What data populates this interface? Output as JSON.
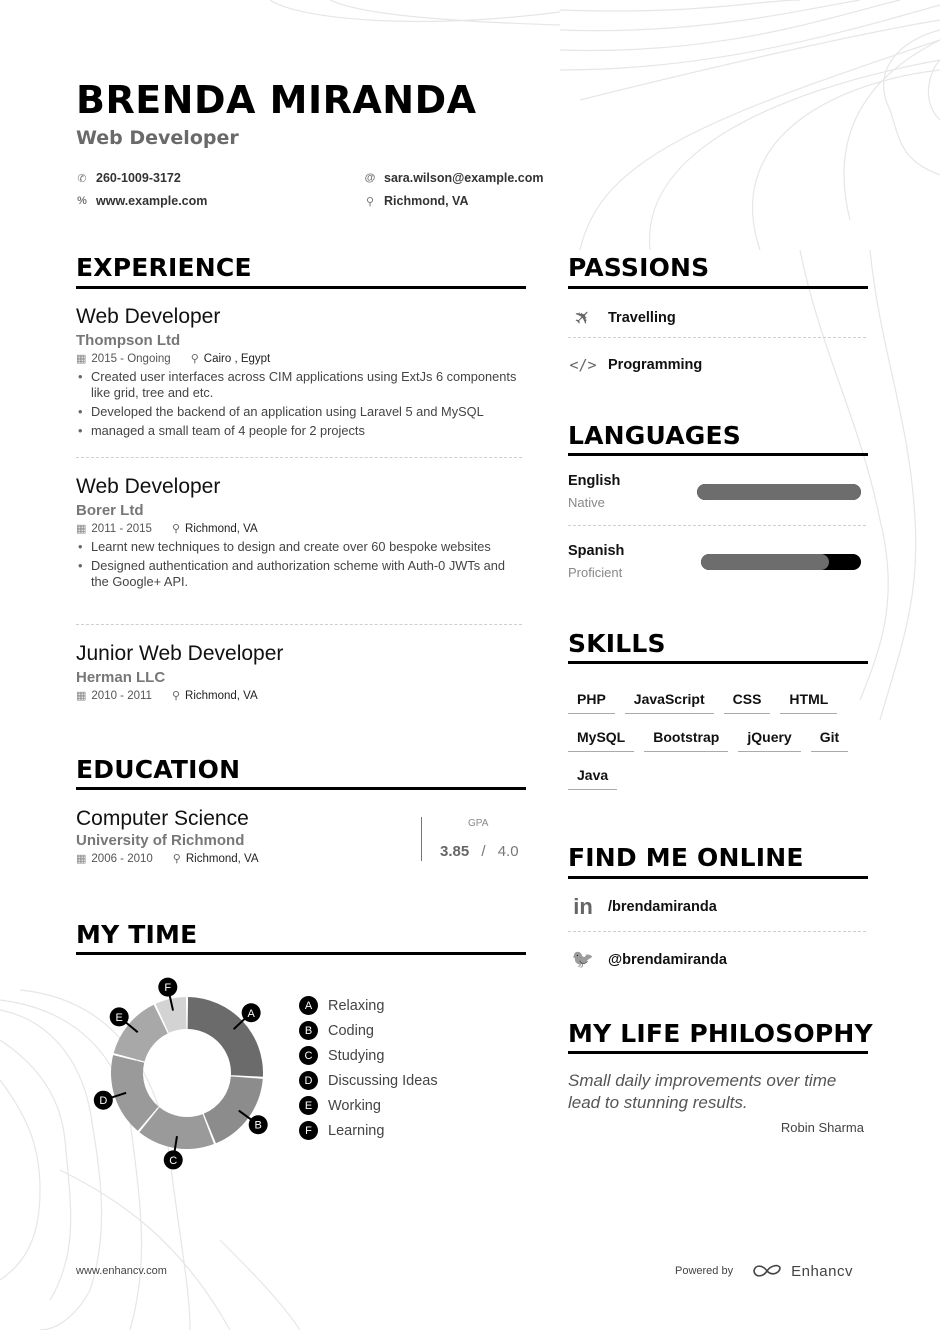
{
  "header": {
    "name": "BRENDA MIRANDA",
    "title": "Web Developer",
    "contacts": [
      {
        "icon": "phone-icon",
        "glyph": "✆",
        "value": "260-1009-3172"
      },
      {
        "icon": "at-icon",
        "glyph": "@",
        "value": "sara.wilson@example.com"
      },
      {
        "icon": "link-icon",
        "glyph": "%",
        "value": "www.example.com"
      },
      {
        "icon": "location-pin-icon",
        "glyph": "⚲",
        "value": "Richmond, VA"
      }
    ]
  },
  "experience": {
    "heading": "EXPERIENCE",
    "jobs": [
      {
        "title": "Web Developer",
        "company": "Thompson Ltd",
        "dates": "2015 - Ongoing",
        "location": "Cairo , Egypt",
        "bullets": [
          "Created user interfaces across CIM applications using ExtJs 6 components like grid, tree and etc.",
          "Developed the backend of an application using Laravel 5 and MySQL",
          "managed a small team of 4 people for 2 projects"
        ]
      },
      {
        "title": "Web Developer",
        "company": "Borer Ltd",
        "dates": "2011 - 2015",
        "location": "Richmond, VA",
        "bullets": [
          "Learnt new techniques to design and create over 60 bespoke websites",
          "Designed authentication and authorization scheme with Auth-0 JWTs and the Google+ API."
        ]
      },
      {
        "title": "Junior Web Developer",
        "company": "Herman LLC",
        "dates": "2010 - 2011",
        "location": "Richmond, VA",
        "bullets": []
      }
    ]
  },
  "education": {
    "heading": "EDUCATION",
    "degree": "Computer Science",
    "school": "University of Richmond",
    "dates": "2006 - 2010",
    "location": "Richmond, VA",
    "gpa_label": "GPA",
    "gpa": "3.85",
    "gpa_sep": "/",
    "gpa_max": "4.0"
  },
  "my_time": {
    "heading": "MY TIME",
    "legend": [
      {
        "key": "A",
        "label": "Relaxing"
      },
      {
        "key": "B",
        "label": "Coding"
      },
      {
        "key": "C",
        "label": "Studying"
      },
      {
        "key": "D",
        "label": "Discussing Ideas"
      },
      {
        "key": "E",
        "label": "Working"
      },
      {
        "key": "F",
        "label": "Learning"
      }
    ]
  },
  "chart_data": {
    "type": "pie",
    "title": "MY TIME",
    "categories": [
      "Relaxing",
      "Coding",
      "Studying",
      "Discussing Ideas",
      "Working",
      "Learning"
    ],
    "keys": [
      "A",
      "B",
      "C",
      "D",
      "E",
      "F"
    ],
    "values": [
      26,
      18,
      17,
      18,
      14,
      7
    ],
    "colors": [
      "#6b6b6b",
      "#8c8c8c",
      "#9a9a9a",
      "#9a9a9a",
      "#a8a8a8",
      "#d3d3d3"
    ],
    "donut": true,
    "legend": "right"
  },
  "passions": {
    "heading": "PASSIONS",
    "items": [
      {
        "icon": "airplane-icon",
        "glyph": "✈",
        "label": "Travelling"
      },
      {
        "icon": "code-icon",
        "glyph": "</>",
        "label": "Programming"
      }
    ]
  },
  "languages": {
    "heading": "LANGUAGES",
    "items": [
      {
        "name": "English",
        "level": "Native",
        "proficiency": 1.0
      },
      {
        "name": "Spanish",
        "level": "Proficient",
        "proficiency": 0.8
      }
    ]
  },
  "skills": {
    "heading": "SKILLS",
    "items": [
      "PHP",
      "JavaScript",
      "CSS",
      "HTML",
      "MySQL",
      "Bootstrap",
      "jQuery",
      "Git",
      "Java"
    ]
  },
  "online": {
    "heading": "FIND ME ONLINE",
    "items": [
      {
        "icon": "linkedin-icon",
        "glyph": "in",
        "label": "/brendamiranda"
      },
      {
        "icon": "twitter-icon",
        "glyph": "🐦",
        "label": "@brendamiranda"
      }
    ]
  },
  "philosophy": {
    "heading": "MY LIFE PHILOSOPHY",
    "quote": "Small daily improvements over time lead to stunning results.",
    "author": "Robin Sharma"
  },
  "footer": {
    "site": "www.enhancv.com",
    "powered_by": "Powered by",
    "brand": "Enhancv"
  }
}
